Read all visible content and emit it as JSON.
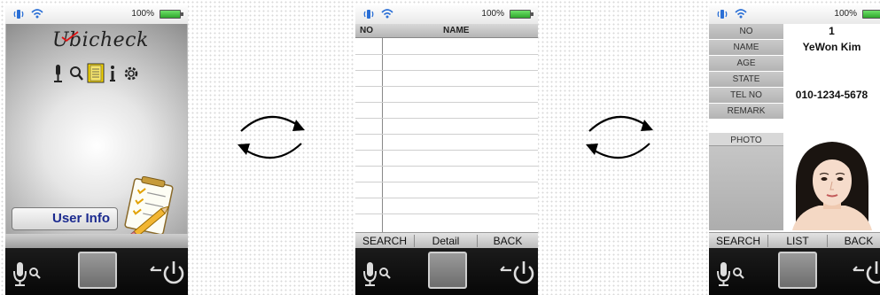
{
  "statusbar": {
    "battery_text": "100%"
  },
  "screen1": {
    "logo_text": "Ubicheck",
    "user_info_label": "User Info",
    "icons": [
      "microphone-icon",
      "search-icon",
      "notebook-icon",
      "info-icon",
      "gear-icon"
    ]
  },
  "screen2": {
    "columns": {
      "no": "NO",
      "name": "NAME"
    },
    "buttons": {
      "search": "SEARCH",
      "detail": "Detail",
      "back": "BACK"
    }
  },
  "screen3": {
    "fields": [
      {
        "label": "NO",
        "value": "1"
      },
      {
        "label": "NAME",
        "value": "YeWon Kim"
      },
      {
        "label": "AGE",
        "value": ""
      },
      {
        "label": "STATE",
        "value": ""
      },
      {
        "label": "TEL NO",
        "value": "010-1234-5678"
      },
      {
        "label": "REMARK",
        "value": ""
      }
    ],
    "photo_label": "PHOTO",
    "buttons": {
      "search": "SEARCH",
      "list": "LIST",
      "back": "BACK"
    }
  },
  "colors": {
    "user_info_text": "#1b2a8f",
    "battery": "#2fa72c",
    "bottom_bar": "#0b0b0b"
  }
}
